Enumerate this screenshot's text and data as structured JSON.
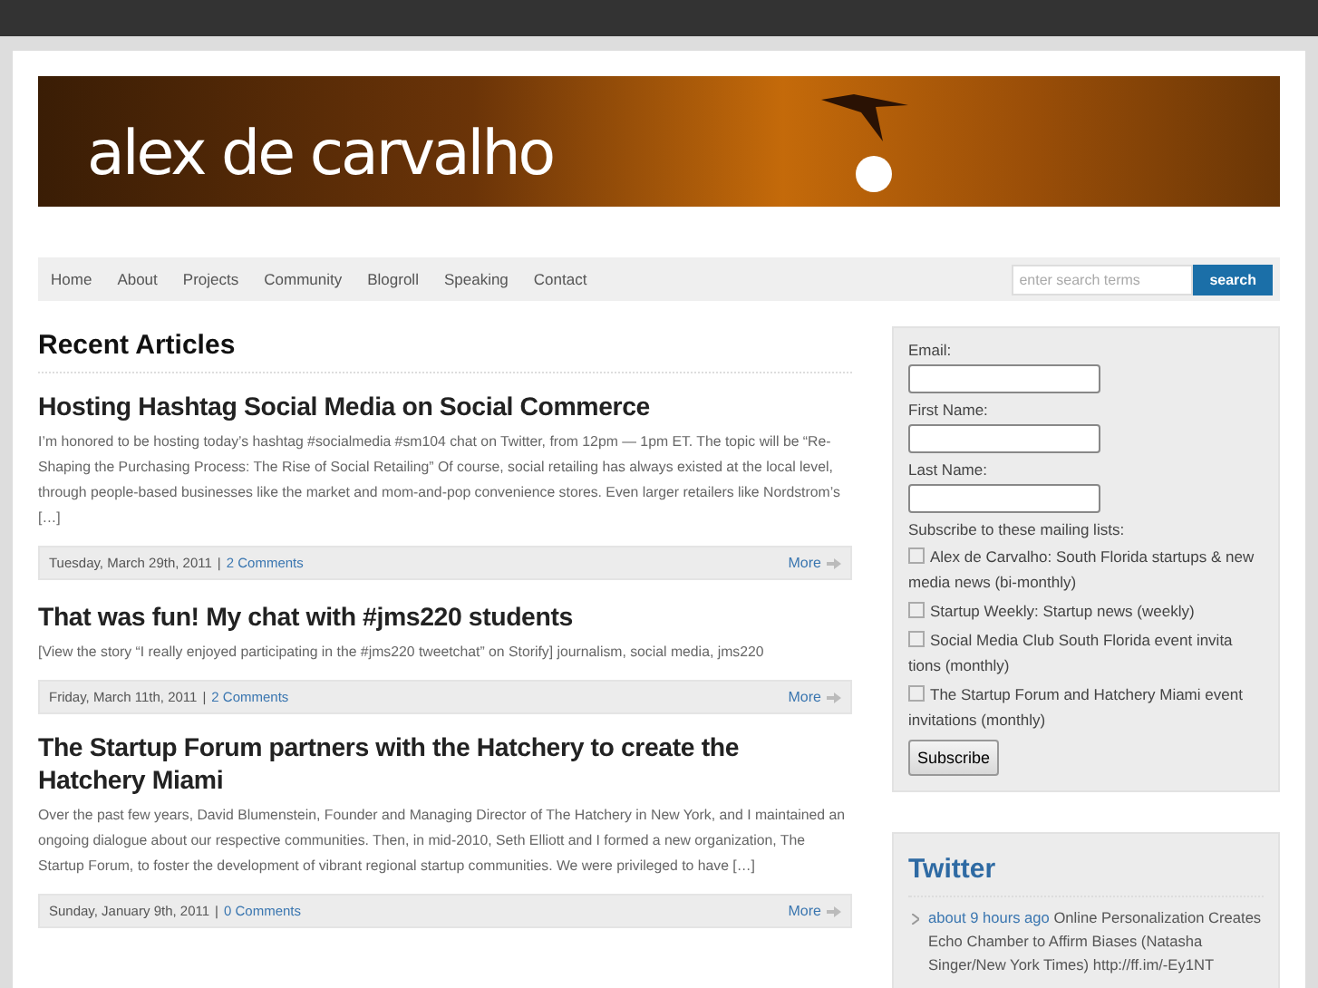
{
  "site": {
    "title": "alex de carvalho"
  },
  "nav": {
    "items": [
      {
        "label": "Home"
      },
      {
        "label": "About"
      },
      {
        "label": "Projects"
      },
      {
        "label": "Community"
      },
      {
        "label": "Blogroll"
      },
      {
        "label": "Speaking"
      },
      {
        "label": "Contact"
      }
    ],
    "search": {
      "placeholder": "enter search terms",
      "button": "search"
    }
  },
  "main": {
    "heading": "Recent Articles",
    "articles": [
      {
        "title": "Hosting Hashtag Social Media on Social Commerce",
        "excerpt": "I’m honored to be hosting today’s hashtag #socialmedia #sm104 chat on Twitter, from 12pm — 1pm ET. The topic will be “Re-Shaping the Purchasing Process: The Rise of Social Retailing” Of course, social retailing has always existed at the local level, through people-based businesses like the market and mom-and-pop convenience stores. Even larger retailers like Nordstrom’s […]",
        "date": "Tuesday, March 29th, 2011",
        "separator": "|",
        "comments": "2 Comments",
        "more": "More"
      },
      {
        "title": "That was fun! My chat with #jms220 students",
        "excerpt": "[View the story “I really enjoyed participating in the #jms220 tweetchat” on Storify] journalism, social media, jms220",
        "date": "Friday, March 11th, 2011",
        "separator": "|",
        "comments": "2 Comments",
        "more": "More"
      },
      {
        "title": "The Startup Forum partners with the Hatchery to create the Hatchery Miami",
        "excerpt": "Over the past few years, David Blumenstein, Founder and Managing Director of The Hatchery in New York, and I maintained an ongoing dialogue about our respective communities. Then, in mid-2010, Seth Elliott and I formed a new organization, The Startup Forum, to foster the development of vibrant regional startup communities. We were privileged to have […]",
        "date": "Sunday, January 9th, 2011",
        "separator": "|",
        "comments": "0 Comments",
        "more": "More"
      }
    ]
  },
  "signup": {
    "fields": [
      {
        "label": "Email:"
      },
      {
        "label": "First Name:"
      },
      {
        "label": "Last Name:"
      }
    ],
    "lists_label": "Subscribe to these mailing lists:",
    "lists": [
      {
        "label": "Alex de Carvalho: South Florida startups & new media news (bi-monthly)",
        "checked": false
      },
      {
        "label": "Startup Weekly: Startup news (weekly)",
        "checked": false
      },
      {
        "label": "Social Media Club South Florida event invita tions (monthly)",
        "checked": false
      },
      {
        "label": "The Startup Forum and Hatchery Miami event invitations (monthly)",
        "checked": false
      }
    ],
    "button": "Subscribe"
  },
  "twitter": {
    "heading": "Twitter",
    "tweets": [
      {
        "time": "about 9 hours ago",
        "text": "Online Personalization Creates Echo Chamber to Affirm Biases (Natasha Singer/New York Times) http://ff.im/-Ey1NT"
      }
    ]
  }
}
